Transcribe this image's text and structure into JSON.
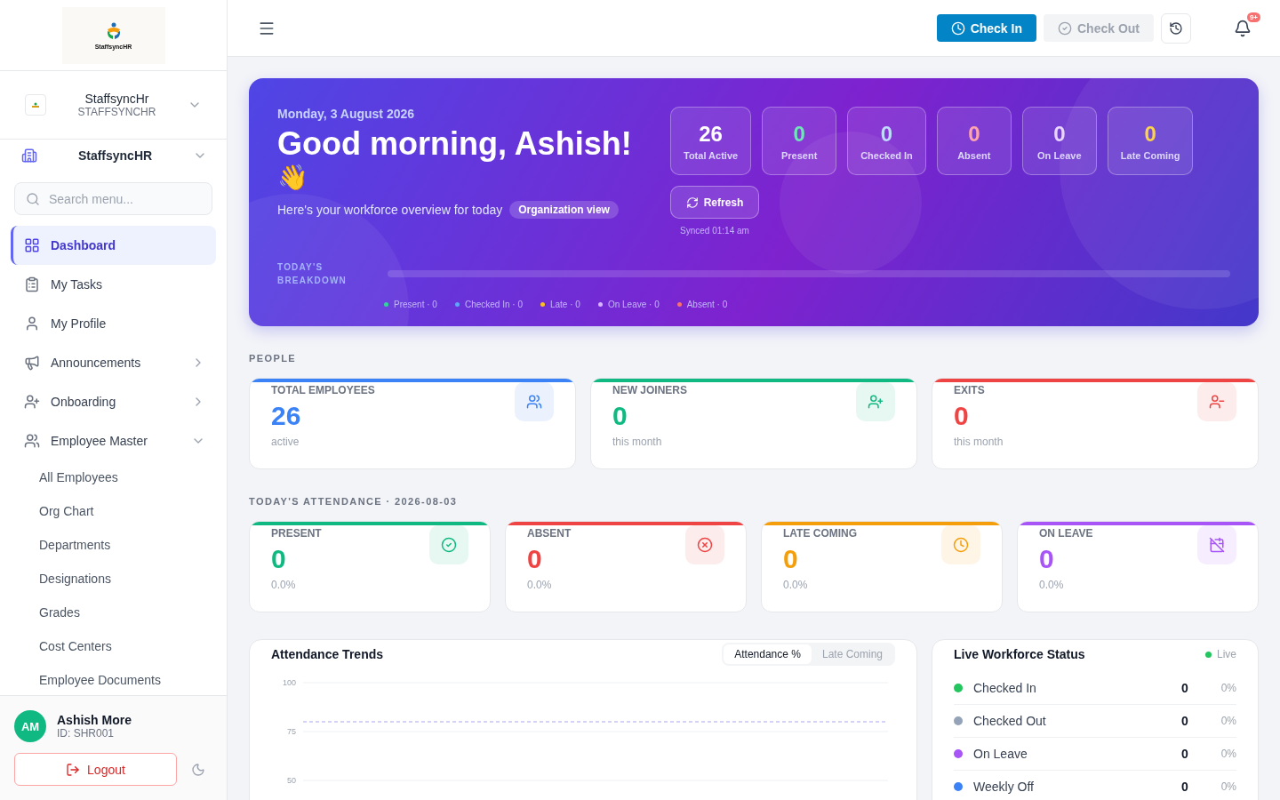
{
  "sidebar": {
    "logo_text": "StaffsyncHR",
    "org": {
      "name": "StaffsyncHr",
      "code": "STAFFSYNCHR"
    },
    "company": {
      "name": "StaffsyncHR"
    },
    "search": {
      "placeholder": "Search menu..."
    },
    "items": [
      {
        "label": "Dashboard",
        "selected": true
      },
      {
        "label": "My Tasks",
        "selected": false
      },
      {
        "label": "My Profile",
        "selected": false
      },
      {
        "label": "Announcements",
        "selected": false,
        "expanded": false
      },
      {
        "label": "Onboarding",
        "selected": false,
        "expanded": false
      },
      {
        "label": "Employee Master",
        "selected": false,
        "expanded": true,
        "children": [
          {
            "label": "All Employees",
            "selected": false
          },
          {
            "label": "Org Chart",
            "selected": false
          },
          {
            "label": "Departments",
            "selected": false
          },
          {
            "label": "Designations",
            "selected": false
          },
          {
            "label": "Grades",
            "selected": false
          },
          {
            "label": "Cost Centers",
            "selected": false
          },
          {
            "label": "Employee Documents",
            "selected": false
          }
        ]
      }
    ],
    "user": {
      "initials": "AM",
      "name": "Ashish More",
      "id": "ID: SHR001"
    },
    "logout": "Logout"
  },
  "header": {
    "check_in": {
      "label": "Check In",
      "disabled": false
    },
    "check_out": {
      "label": "Check Out",
      "disabled": true
    },
    "notification_badge": "9+"
  },
  "hero": {
    "date": "Monday, 3 August 2026",
    "greeting": "Good morning, Ashish!",
    "wave": "👋",
    "subtitle": "Here's your workforce overview for today",
    "scope": "Organization view",
    "stats": [
      {
        "value": "26",
        "label": "Total Active",
        "color": "#ffffff"
      },
      {
        "value": "0",
        "label": "Present",
        "color": "#6ee7b7"
      },
      {
        "value": "0",
        "label": "Checked In",
        "color": "#bfdbfe"
      },
      {
        "value": "0",
        "label": "Absent",
        "color": "#fda4af"
      },
      {
        "value": "0",
        "label": "On Leave",
        "color": "#e9d5ff"
      },
      {
        "value": "0",
        "label": "Late Coming",
        "color": "#fcd34d"
      }
    ],
    "refresh": "Refresh",
    "synced": "Synced 01:14 am",
    "breakdown_title": "TODAY'S BREAKDOWN",
    "legend": [
      {
        "label": "Present · 0",
        "color": "#34d399"
      },
      {
        "label": "Checked In · 0",
        "color": "#60a5fa"
      },
      {
        "label": "Late · 0",
        "color": "#fbbf24"
      },
      {
        "label": "On Leave · 0",
        "color": "#d8b4fe"
      },
      {
        "label": "Absent · 0",
        "color": "#f87171"
      }
    ]
  },
  "people": {
    "title": "PEOPLE",
    "cards": [
      {
        "title": "TOTAL EMPLOYEES",
        "value": "26",
        "sub": "active",
        "color": "#3b82f6"
      },
      {
        "title": "NEW JOINERS",
        "value": "0",
        "sub": "this month",
        "color": "#10b981"
      },
      {
        "title": "EXITS",
        "value": "0",
        "sub": "this month",
        "color": "#ef4444"
      }
    ]
  },
  "attendance": {
    "title": "TODAY'S ATTENDANCE · 2026-08-03",
    "cards": [
      {
        "title": "PRESENT",
        "value": "0",
        "sub": "0.0%",
        "color": "#10b981"
      },
      {
        "title": "ABSENT",
        "value": "0",
        "sub": "0.0%",
        "color": "#ef4444"
      },
      {
        "title": "LATE COMING",
        "value": "0",
        "sub": "0.0%",
        "color": "#f59e0b"
      },
      {
        "title": "ON LEAVE",
        "value": "0",
        "sub": "0.0%",
        "color": "#a855f7"
      }
    ]
  },
  "trends": {
    "title": "Attendance Trends",
    "tabs": [
      {
        "label": "Attendance %",
        "selected": true
      },
      {
        "label": "Late Coming",
        "selected": false
      }
    ],
    "chart": {
      "y_labels": [
        "100",
        "75",
        "50"
      ],
      "target_line": true
    }
  },
  "live": {
    "title": "Live Workforce Status",
    "badge": "Live",
    "rows": [
      {
        "label": "Checked In",
        "count": "0",
        "pct": "0%",
        "color": "#22c55e"
      },
      {
        "label": "Checked Out",
        "count": "0",
        "pct": "0%",
        "color": "#94a3b8"
      },
      {
        "label": "On Leave",
        "count": "0",
        "pct": "0%",
        "color": "#a855f7"
      },
      {
        "label": "Weekly Off",
        "count": "0",
        "pct": "0%",
        "color": "#3b82f6"
      }
    ]
  }
}
